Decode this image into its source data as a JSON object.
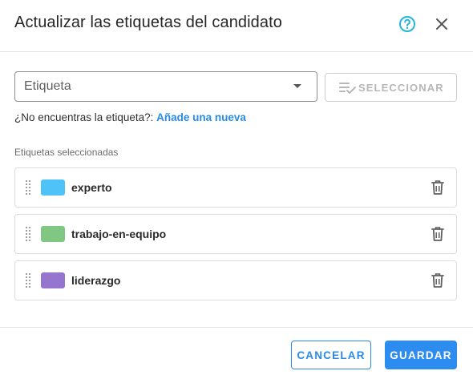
{
  "dialog": {
    "title": "Actualizar las etiquetas del candidato",
    "help_icon": "help-circle-icon",
    "close_icon": "close-icon"
  },
  "tag_select": {
    "placeholder": "Etiqueta",
    "select_button_label": "SELECCIONAR",
    "select_button_icon": "playlist-check-icon",
    "select_button_enabled": false
  },
  "hint": {
    "text": "¿No encuentras la etiqueta?:",
    "link_label": "Añade una nueva"
  },
  "selected_tags": {
    "section_label": "Etiquetas seleccionadas",
    "items": [
      {
        "label": "experto",
        "color": "#4fc3f7"
      },
      {
        "label": "trabajo-en-equipo",
        "color": "#81c784"
      },
      {
        "label": "liderazgo",
        "color": "#9575cd"
      }
    ]
  },
  "footer": {
    "cancel_label": "CANCELAR",
    "save_label": "GUARDAR"
  },
  "colors": {
    "accent": "#2a8be6",
    "primary_button": "#2d8cf0",
    "help_icon": "#26b5d9"
  }
}
